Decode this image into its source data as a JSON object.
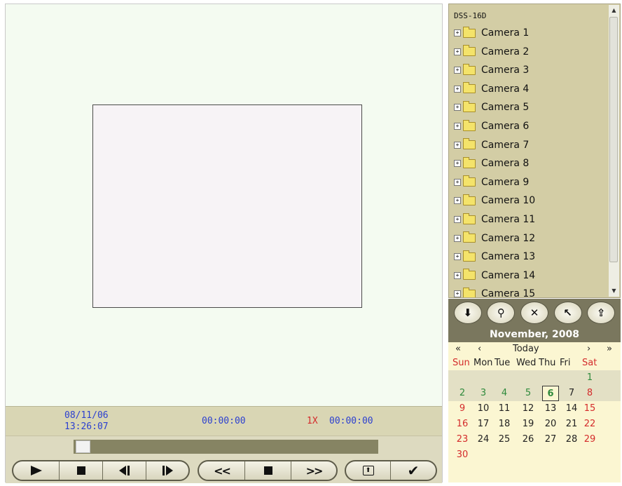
{
  "player": {
    "date": "08/11/06",
    "time": "13:26:07",
    "elapsed": "00:00:00",
    "speed": "1X",
    "speed_time": "00:00:00"
  },
  "controls": {
    "playback": [
      "play-icon",
      "stop-icon",
      "step-back-icon",
      "step-forward-icon"
    ],
    "seek": [
      "rewind-icon",
      "stop-icon",
      "fast-forward-icon"
    ],
    "extra": [
      "snapshot-icon",
      "confirm-icon"
    ],
    "rewind_glyph": "<<",
    "forward_glyph": ">>",
    "confirm_glyph": "✔",
    "snapshot_glyph": "⬆"
  },
  "tree": {
    "root": "DSS-16D",
    "cameras": [
      "Camera 1",
      "Camera 2",
      "Camera 3",
      "Camera 4",
      "Camera 5",
      "Camera 6",
      "Camera 7",
      "Camera 8",
      "Camera 9",
      "Camera 10",
      "Camera 11",
      "Camera 12",
      "Camera 13",
      "Camera 14",
      "Camera 15"
    ],
    "expander": "+",
    "scroll_up": "▲",
    "scroll_down": "▼"
  },
  "toolbar": {
    "buttons": [
      "download-icon",
      "search-person-icon",
      "delete-icon",
      "back-icon",
      "export-icon"
    ],
    "glyphs": [
      "⬇",
      "⚲",
      "✕",
      "↖",
      "⇪"
    ]
  },
  "calendar": {
    "title": "November, 2008",
    "prev_year": "«",
    "prev_month": "‹",
    "today": "Today",
    "next_month": "›",
    "next_year": "»",
    "weekdays": [
      "Sun",
      "Mon",
      "Tue",
      "Wed",
      "Thu",
      "Fri",
      "Sat"
    ],
    "weeks": [
      [
        "",
        "",
        "",
        "",
        "",
        "",
        "1"
      ],
      [
        "2",
        "3",
        "4",
        "5",
        "6",
        "7",
        "8"
      ],
      [
        "9",
        "10",
        "11",
        "12",
        "13",
        "14",
        "15"
      ],
      [
        "16",
        "17",
        "18",
        "19",
        "20",
        "21",
        "22"
      ],
      [
        "23",
        "24",
        "25",
        "26",
        "27",
        "28",
        "29"
      ],
      [
        "30",
        "",
        "",
        "",
        "",
        "",
        ""
      ]
    ],
    "selected_day": "6",
    "colors": {
      "weekend": "#d42b2b",
      "past": "#2f8a3c",
      "header": "#7a775e"
    }
  }
}
